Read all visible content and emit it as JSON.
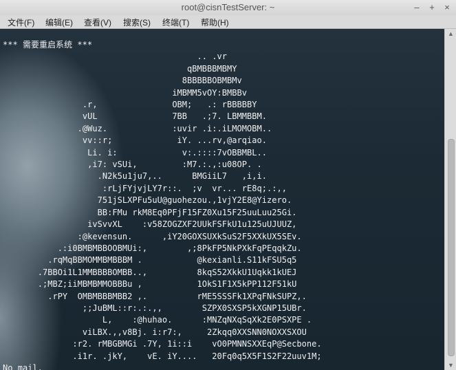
{
  "window": {
    "title": "root@cisnTestServer: ~"
  },
  "controls": {
    "minimize": "–",
    "maximize": "+",
    "close": "×"
  },
  "menu": [
    "文件(F)",
    "编辑(E)",
    "查看(V)",
    "搜索(S)",
    "终端(T)",
    "帮助(H)"
  ],
  "terminal": {
    "lines": [
      "*** 需要重启系统 ***",
      "                                       .. .vr",
      "                                     qBMBBBMBMY",
      "                                    8BBBBBOBMBMv",
      "                                  iMBMM5vOY:BMBBv",
      "                .r,               OBM;   .: rBBBBBY",
      "                vUL               7BB   .;7. LBMMBBM.",
      "               .@Wuz.             :uvir .i:.iLMOMOBM..",
      "                vv::r;             iY. ...rv,@arqiao.",
      "                 Li. i:             v:.::::7vOBBMBL..",
      "                 ,i7: vSUi,         :M7.:.,:u08OP. .",
      "                   .N2k5u1ju7,..      BMGiiL7   ,i,i.",
      "                    :rLjFYjvjLY7r::.  ;v  vr... rE8q;.:,,",
      "                   751jSLXPFu5uU@guohezou.,1vjY2E8@Yizero.",
      "                   BB:FMu rkM8Eq0PFjF15FZ0Xu15F25uuLuu25Gi.",
      "                 ivSvvXL    :v58ZOGZXF2UUkFSFkU1u125uUJUUZ,",
      "               :@kevensun.      ,iY20GOXSUXkSuS2F5XXkUX5SEv.",
      "           .:i0BMBMBBOOBMUi:,        ,;8PkFP5NkPXkFqPEqqkZu.",
      "         .rqMqBBMOMMBMBBBM .           @kexianli.S11kFSU5q5",
      "       .7BBOi1L1MMBBBBOMBB..,          8kqS52XkkU1Uqkk1kUEJ",
      "       .;MBZ;iiMBMBMMOBBBu ,           1OkS1F1X5kPP112F51kU",
      "         .rPY  OMBMBBBMBB2 ,.          rME5SSSFk1XPqFNkSUPZ,.",
      "                ;;JuBML::r:.:.,,        SZPX0SXSP5kXGNP15UBr.",
      "                    L,    :@huhao.      :MNZqNXqSqXk2E0PSXPE .",
      "                viLBX.,,v8Bj. i:r7:,     2Zkqq0XXSNN0NOXXSXOU",
      "              :r2. rMBGBMGi .7Y, 1i::i    vO0PMNNSXXEqP@Secbone.",
      "              .i1r. .jkY,    vE. iY....   20Fq0q5X5F1S2F22uuv1M;",
      "No mail."
    ]
  }
}
